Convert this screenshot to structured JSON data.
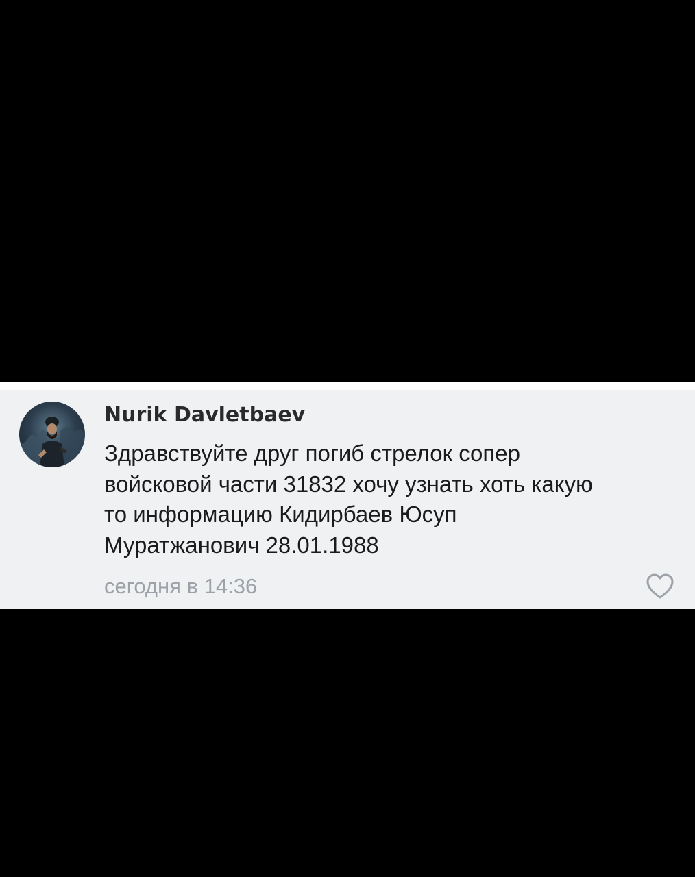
{
  "comment": {
    "author_name": "Nurik Davletbaev",
    "text_lines": [
      "Здравствуйте друг погиб стрелок сопер",
      "войсковой части 31832 хочу узнать хоть какую",
      "то информацию Кидирбаев Юсуп",
      "Муратжанович 28.01.1988"
    ],
    "timestamp": "сегодня в 14:36",
    "avatar_icon": "user-avatar-photo",
    "like_icon": "heart-outline-icon"
  },
  "colors": {
    "card_background": "#f0f1f3",
    "author_text": "#2a2a2a",
    "body_text": "#1b1b1b",
    "muted_text": "#9da2a8",
    "letterbox": "#000000"
  }
}
